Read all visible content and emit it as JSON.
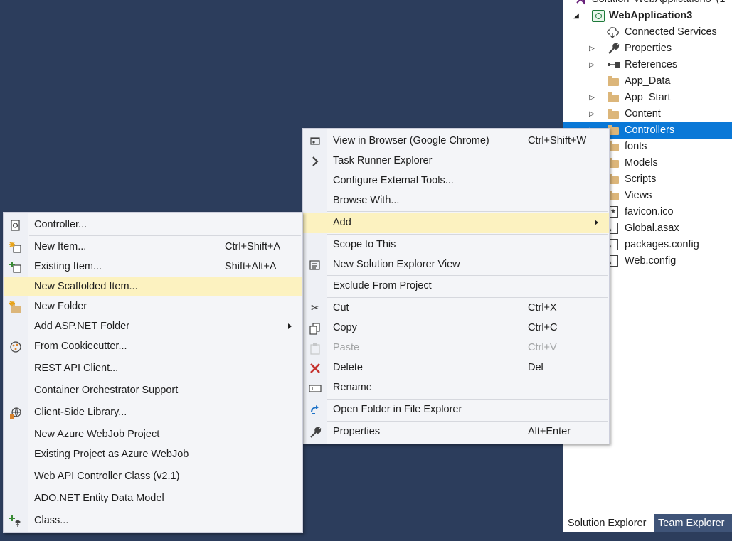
{
  "solution_explorer": {
    "items": [
      {
        "label": "Solution 'WebApplication3' (1"
      },
      {
        "label": "WebApplication3"
      },
      {
        "label": "Connected Services"
      },
      {
        "label": "Properties"
      },
      {
        "label": "References"
      },
      {
        "label": "App_Data"
      },
      {
        "label": "App_Start"
      },
      {
        "label": "Content"
      },
      {
        "label": "Controllers"
      },
      {
        "label": "fonts"
      },
      {
        "label": "Models"
      },
      {
        "label": "Scripts"
      },
      {
        "label": "Views"
      },
      {
        "label": "favicon.ico"
      },
      {
        "label": "Global.asax"
      },
      {
        "label": "packages.config"
      },
      {
        "label": "Web.config"
      }
    ],
    "selected": "Controllers",
    "tabs": [
      "Solution Explorer",
      "Team Explorer"
    ]
  },
  "context_menu": {
    "items": [
      {
        "label": "View in Browser (Google Chrome)",
        "shortcut": "Ctrl+Shift+W",
        "icon": "browser-icon"
      },
      {
        "label": "Task Runner Explorer",
        "shortcut": "",
        "icon": "chevron-right-icon"
      },
      {
        "label": "Configure External Tools...",
        "shortcut": ""
      },
      {
        "label": "Browse With...",
        "shortcut": ""
      },
      {
        "label": "Add",
        "shortcut": "",
        "submenu": true,
        "highlighted": true
      },
      {
        "label": "Scope to This",
        "shortcut": ""
      },
      {
        "label": "New Solution Explorer View",
        "shortcut": "",
        "icon": "new-view-icon"
      },
      {
        "label": "Exclude From Project",
        "shortcut": ""
      },
      {
        "label": "Cut",
        "shortcut": "Ctrl+X",
        "icon": "scissors-icon"
      },
      {
        "label": "Copy",
        "shortcut": "Ctrl+C",
        "icon": "copy-icon"
      },
      {
        "label": "Paste",
        "shortcut": "Ctrl+V",
        "icon": "paste-icon",
        "disabled": true
      },
      {
        "label": "Delete",
        "shortcut": "Del",
        "icon": "delete-icon"
      },
      {
        "label": "Rename",
        "shortcut": "",
        "icon": "rename-icon"
      },
      {
        "label": "Open Folder in File Explorer",
        "shortcut": "",
        "icon": "refresh-arrow-icon"
      },
      {
        "label": "Properties",
        "shortcut": "Alt+Enter",
        "icon": "wrench-icon"
      }
    ]
  },
  "add_submenu": {
    "items": [
      {
        "label": "Controller...",
        "shortcut": "",
        "icon": "controller-icon"
      },
      {
        "label": "New Item...",
        "shortcut": "Ctrl+Shift+A",
        "icon": "new-item-icon"
      },
      {
        "label": "Existing Item...",
        "shortcut": "Shift+Alt+A",
        "icon": "existing-item-icon"
      },
      {
        "label": "New Scaffolded Item...",
        "shortcut": "",
        "highlighted": true
      },
      {
        "label": "New Folder",
        "shortcut": "",
        "icon": "new-folder-icon"
      },
      {
        "label": "Add ASP.NET Folder",
        "shortcut": "",
        "submenu": true
      },
      {
        "label": "From Cookiecutter...",
        "shortcut": "",
        "icon": "cookiecutter-icon"
      },
      {
        "label": "REST API Client...",
        "shortcut": ""
      },
      {
        "label": "Container Orchestrator Support",
        "shortcut": ""
      },
      {
        "label": "Client-Side Library...",
        "shortcut": "",
        "icon": "globe-icon"
      },
      {
        "label": "New Azure WebJob Project",
        "shortcut": ""
      },
      {
        "label": "Existing Project as Azure WebJob",
        "shortcut": ""
      },
      {
        "label": "Web API Controller Class (v2.1)",
        "shortcut": ""
      },
      {
        "label": "ADO.NET Entity Data Model",
        "shortcut": ""
      },
      {
        "label": "Class...",
        "shortcut": "",
        "icon": "add-class-icon"
      }
    ]
  },
  "colors": {
    "background": "#2c3d5c",
    "selection": "#0a78d7",
    "menu_highlight": "#fcf2c0",
    "folder": "#dcb67a"
  }
}
